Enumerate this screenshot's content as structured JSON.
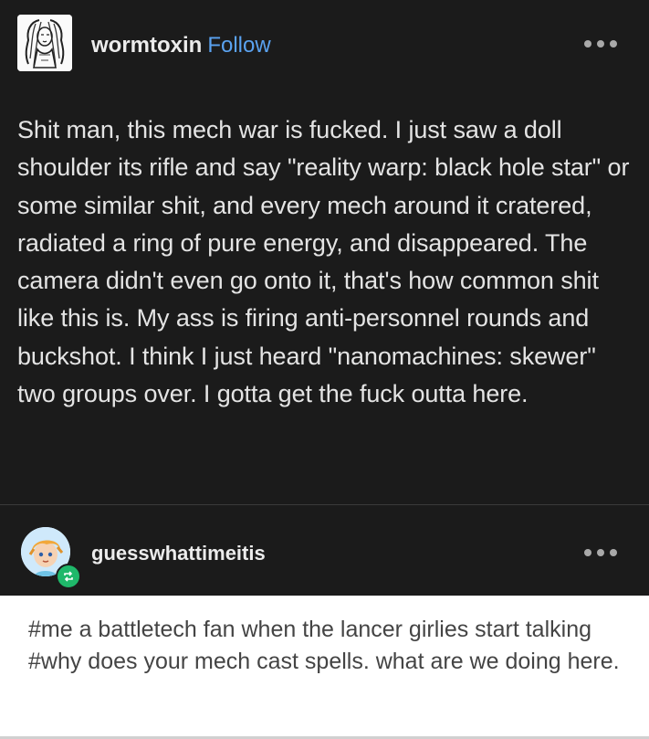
{
  "post": {
    "username": "wormtoxin",
    "follow_label": "Follow",
    "body": "Shit man, this mech war is fucked. I just saw a doll shoulder its rifle and say \"reality warp: black hole star\" or some similar shit, and every mech around it cratered, radiated a ring of pure energy, and disappeared. The camera didn't even go onto it, that's how common shit like this is. My ass is firing anti-personnel rounds and buckshot. I think I just heard \"nanomachines: skewer\" two groups over. I gotta get the fuck outta here."
  },
  "reblog": {
    "username": "guesswhattimeitis",
    "tags": "#me a battletech fan when the lancer girlies start talking  #why does your mech cast spells. what are we doing here."
  },
  "colors": {
    "background": "#1b1b1b",
    "follow_link": "#5aa2f0",
    "reblog_badge": "#1fb86a",
    "tags_panel": "#ffffff"
  },
  "icons": {
    "post_more": "more-options-icon",
    "reblog_more": "more-options-icon",
    "reblog_badge": "reblog-icon"
  }
}
